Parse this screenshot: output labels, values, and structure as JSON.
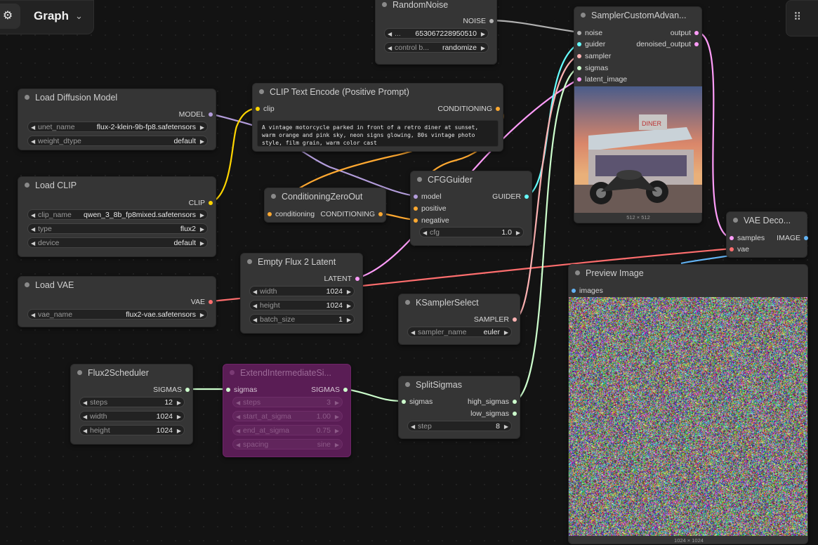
{
  "topbar": {
    "title": "Graph",
    "logo_icon": "workflow-graph-icon",
    "chevron": "chevron-down-icon"
  },
  "topright": {
    "icon": "drag-handle-icon"
  },
  "colors": {
    "model": "#b39ddb",
    "clip": "#ffd500",
    "vae": "#ff6e6e",
    "conditioning": "#ffa931",
    "latent": "#ff9cf9",
    "noise": "#b0b0b0",
    "sigmas": "#cdffcd",
    "sampler": "#ffb3b3",
    "guider": "#66ffff",
    "image": "#64b5f6"
  },
  "nodes": {
    "load_diffusion": {
      "title": "Load Diffusion Model",
      "out": "MODEL",
      "w0_label": "unet_name",
      "w0_value": "flux-2-klein-9b-fp8.safetensors",
      "w1_label": "weight_dtype",
      "w1_value": "default"
    },
    "load_clip": {
      "title": "Load CLIP",
      "out": "CLIP",
      "w0_label": "clip_name",
      "w0_value": "qwen_3_8b_fp8mixed.safetensors",
      "w1_label": "type",
      "w1_value": "flux2",
      "w2_label": "device",
      "w2_value": "default"
    },
    "load_vae": {
      "title": "Load VAE",
      "out": "VAE",
      "w0_label": "vae_name",
      "w0_value": "flux2-vae.safetensors"
    },
    "flux_sched": {
      "title": "Flux2Scheduler",
      "out": "SIGMAS",
      "w0_label": "steps",
      "w0_value": "12",
      "w1_label": "width",
      "w1_value": "1024",
      "w2_label": "height",
      "w2_value": "1024"
    },
    "extend": {
      "title": "ExtendIntermediateSi...",
      "in": "sigmas",
      "out": "SIGMAS",
      "w0_label": "steps",
      "w0_value": "3",
      "w1_label": "start_at_sigma",
      "w1_value": "1.00",
      "w2_label": "end_at_sigma",
      "w2_value": "0.75",
      "w3_label": "spacing",
      "w3_value": "sine"
    },
    "empty_latent": {
      "title": "Empty Flux 2 Latent",
      "out": "LATENT",
      "w0_label": "width",
      "w0_value": "1024",
      "w1_label": "height",
      "w1_value": "1024",
      "w2_label": "batch_size",
      "w2_value": "1"
    },
    "clip_encode": {
      "title": "CLIP Text Encode (Positive Prompt)",
      "in": "clip",
      "out": "CONDITIONING",
      "text": "A vintage motorcycle parked in front of a retro diner at sunset, warm orange and pink sky, neon signs glowing, 80s vintage photo style, film grain, warm color cast"
    },
    "cond_zero": {
      "title": "ConditioningZeroOut",
      "in": "conditioning",
      "out": "CONDITIONING"
    },
    "cfg_guider": {
      "title": "CFGGuider",
      "in0": "model",
      "in1": "positive",
      "in2": "negative",
      "out": "GUIDER",
      "w0_label": "cfg",
      "w0_value": "1.0"
    },
    "random_noise": {
      "title": "RandomNoise",
      "out": "NOISE",
      "w0_value": "653067228950510",
      "w0_prefix": "...",
      "w1_label": "control b...",
      "w1_value": "randomize"
    },
    "ksampler_select": {
      "title": "KSamplerSelect",
      "out": "SAMPLER",
      "w0_label": "sampler_name",
      "w0_value": "euler"
    },
    "split_sigmas": {
      "title": "SplitSigmas",
      "in": "sigmas",
      "out0": "high_sigmas",
      "out1": "low_sigmas",
      "w0_label": "step",
      "w0_value": "8"
    },
    "sampler_custom": {
      "title": "SamplerCustomAdvan...",
      "in0": "noise",
      "in1": "guider",
      "in2": "sampler",
      "in3": "sigmas",
      "in4": "latent_image",
      "out0": "output",
      "out1": "denoised_output",
      "caption": "512 × 512"
    },
    "vae_decode": {
      "title": "VAE Deco...",
      "in0": "samples",
      "in1": "vae",
      "out": "IMAGE"
    },
    "preview": {
      "title": "Preview Image",
      "in": "images",
      "caption": "1024 × 1024"
    }
  }
}
